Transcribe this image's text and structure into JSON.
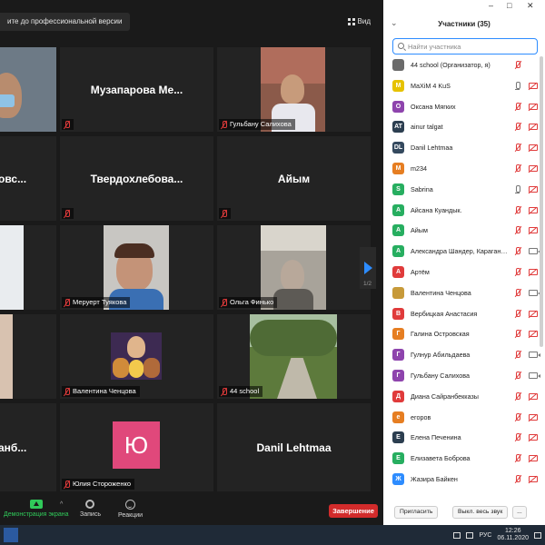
{
  "meeting": {
    "banner": "ите до профессиональной версии",
    "view_label": "Вид",
    "page_indicator": "1/2",
    "tiles": [
      {
        "id": "t0",
        "name": "",
        "label": ""
      },
      {
        "id": "t1",
        "name": "Музапарова Ме...",
        "label": ""
      },
      {
        "id": "t2",
        "name": "",
        "label": "Гульбану Салихова"
      },
      {
        "id": "t3",
        "name": "овс...",
        "label": ""
      },
      {
        "id": "t4",
        "name": "Твердохлебова...",
        "label": ""
      },
      {
        "id": "t5",
        "name": "Айым",
        "label": ""
      },
      {
        "id": "t6",
        "name": "",
        "label": ""
      },
      {
        "id": "t7",
        "name": "",
        "label": "Меруерт Туякова"
      },
      {
        "id": "t8",
        "name": "",
        "label": "Ольга Финько"
      },
      {
        "id": "t9",
        "name": "",
        "label": ""
      },
      {
        "id": "t10",
        "name": "",
        "label": "Валентина Ченцова"
      },
      {
        "id": "t11",
        "name": "",
        "label": "44 school"
      },
      {
        "id": "t12",
        "name": "анб...",
        "label": ""
      },
      {
        "id": "t13",
        "name": "",
        "label": "Юлия Стороженко",
        "avatar_letter": "Ю"
      },
      {
        "id": "t14",
        "name": "Danil Lehtmaa",
        "label": ""
      }
    ]
  },
  "toolbar": {
    "share_label": "Демонстрация экрана",
    "share_caret": "^",
    "record_label": "Запись",
    "reactions_label": "Реакции",
    "end_label": "Завершение"
  },
  "panel": {
    "title": "Участники (35)",
    "collapse_glyph": "⌄",
    "window_controls": {
      "minimize": "–",
      "maximize": "□",
      "close": "✕"
    },
    "search_placeholder": "Найти участника",
    "participants": [
      {
        "initials": "",
        "name": "44 school (Организатор, я)",
        "color": "#6b6b6b",
        "mic": "off",
        "cam": "none",
        "photo": true
      },
      {
        "initials": "M",
        "name": "MaXiM 4 KuS",
        "color": "#e6c200",
        "mic": "on",
        "cam": "off"
      },
      {
        "initials": "О",
        "name": "Оксана Мягких",
        "color": "#8e44ad",
        "mic": "off",
        "cam": "off"
      },
      {
        "initials": "AT",
        "name": "ainur talgat",
        "color": "#2c3e50",
        "mic": "off",
        "cam": "off"
      },
      {
        "initials": "DL",
        "name": "Danil Lehtmaa",
        "color": "#34495e",
        "mic": "off",
        "cam": "off"
      },
      {
        "initials": "M",
        "name": "m234",
        "color": "#e67e22",
        "mic": "off",
        "cam": "off"
      },
      {
        "initials": "S",
        "name": "Sabrina",
        "color": "#27ae60",
        "mic": "on",
        "cam": "off"
      },
      {
        "initials": "А",
        "name": "Айсана Куандык.",
        "color": "#27ae60",
        "mic": "off",
        "cam": "off"
      },
      {
        "initials": "А",
        "name": "Айым",
        "color": "#27ae60",
        "mic": "off",
        "cam": "off"
      },
      {
        "initials": "А",
        "name": "Александра Шандер, Караганд...",
        "color": "#27ae60",
        "mic": "off",
        "cam": "on"
      },
      {
        "initials": "А",
        "name": "Артём",
        "color": "#e03b3b",
        "mic": "off",
        "cam": "off"
      },
      {
        "initials": "",
        "name": "Валентина Ченцова",
        "color": "#c79a3a",
        "mic": "off",
        "cam": "on",
        "photo": true
      },
      {
        "initials": "В",
        "name": "Вербицкая Анастасия",
        "color": "#e03b3b",
        "mic": "off",
        "cam": "off"
      },
      {
        "initials": "Г",
        "name": "Галина Островская",
        "color": "#e67e22",
        "mic": "off",
        "cam": "off"
      },
      {
        "initials": "Г",
        "name": "Гулнур Абильдаева",
        "color": "#8e44ad",
        "mic": "off",
        "cam": "on"
      },
      {
        "initials": "Г",
        "name": "Гульбану Салихова",
        "color": "#8e44ad",
        "mic": "off",
        "cam": "on"
      },
      {
        "initials": "Д",
        "name": "Диана Сайранбекказы",
        "color": "#e03b3b",
        "mic": "off",
        "cam": "off"
      },
      {
        "initials": "е",
        "name": "егоров",
        "color": "#e67e22",
        "mic": "off",
        "cam": "off"
      },
      {
        "initials": "Е",
        "name": "Елена Печенина",
        "color": "#2c3e50",
        "mic": "off",
        "cam": "off"
      },
      {
        "initials": "Е",
        "name": "Елизавета Боброва",
        "color": "#27ae60",
        "mic": "off",
        "cam": "off"
      },
      {
        "initials": "Ж",
        "name": "Жазира Байкен",
        "color": "#2d8cff",
        "mic": "off",
        "cam": "off"
      }
    ],
    "invite_label": "Пригласить",
    "mute_all_label": "Выкл. весь звук",
    "more_label": "..."
  },
  "taskbar": {
    "language": "РУС",
    "time": "12:26",
    "date": "06.11.2020"
  },
  "colors": {
    "accent": "#2d8cff",
    "end_button": "#d22b2b",
    "share_green": "#30c95a",
    "muted_red": "#e03b3b"
  }
}
